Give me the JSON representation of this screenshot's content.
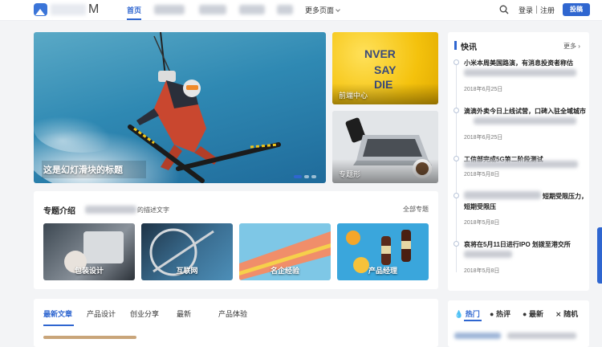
{
  "logo": {
    "suffix": "M"
  },
  "nav": {
    "items": [
      {
        "label": "首页",
        "active": true
      },
      {
        "label": "更多页面",
        "active": false
      }
    ],
    "login": "登录",
    "register": "注册",
    "post": "投稿"
  },
  "hero": {
    "title_visible": "这是幻灯滑块的标题"
  },
  "side_cards": [
    {
      "label": "前端中心",
      "art_text": [
        "NVER",
        "SAY",
        "DIE"
      ]
    },
    {
      "label": "专题形"
    }
  ],
  "topics": {
    "title": "专题介绍",
    "desc_visible": "的描述文字",
    "all": "全部专题",
    "cards": [
      {
        "label": "包装设计"
      },
      {
        "label": "互联网"
      },
      {
        "label": "名企经验"
      },
      {
        "label": "产品经理"
      }
    ]
  },
  "article_tabs": {
    "tabs": [
      {
        "label": "最新文章"
      },
      {
        "label": "产品设计"
      },
      {
        "label": "创业分享"
      },
      {
        "label": "最新"
      },
      {
        "label": "产品体验"
      }
    ]
  },
  "flash": {
    "title": "快讯",
    "more": "更多",
    "items": [
      {
        "text": "小米本周美国路演，有消息投资者称估",
        "date": "2018年6月25日"
      },
      {
        "text": "滴滴外卖今日上线试营，口碑入驻全域城市",
        "date": "2018年6月25日"
      },
      {
        "text": "工信部完成5G第二阶段测试",
        "date": "2018年5月8日"
      },
      {
        "text": "短期受限压力，",
        "text2": "短期受限压",
        "date": "2018年5月8日"
      },
      {
        "text": "哀将在5月11日进行IPO 划拨至港交所",
        "date": "2018年5月8日"
      }
    ]
  },
  "hot": {
    "tabs": [
      {
        "label": "热门",
        "icon": "flame-icon"
      },
      {
        "label": "热评",
        "icon": "chat-icon"
      },
      {
        "label": "最新",
        "icon": "clock-icon"
      },
      {
        "label": "随机",
        "icon": "shuffle-icon"
      }
    ]
  },
  "colors": {
    "accent": "#2f66d0"
  }
}
